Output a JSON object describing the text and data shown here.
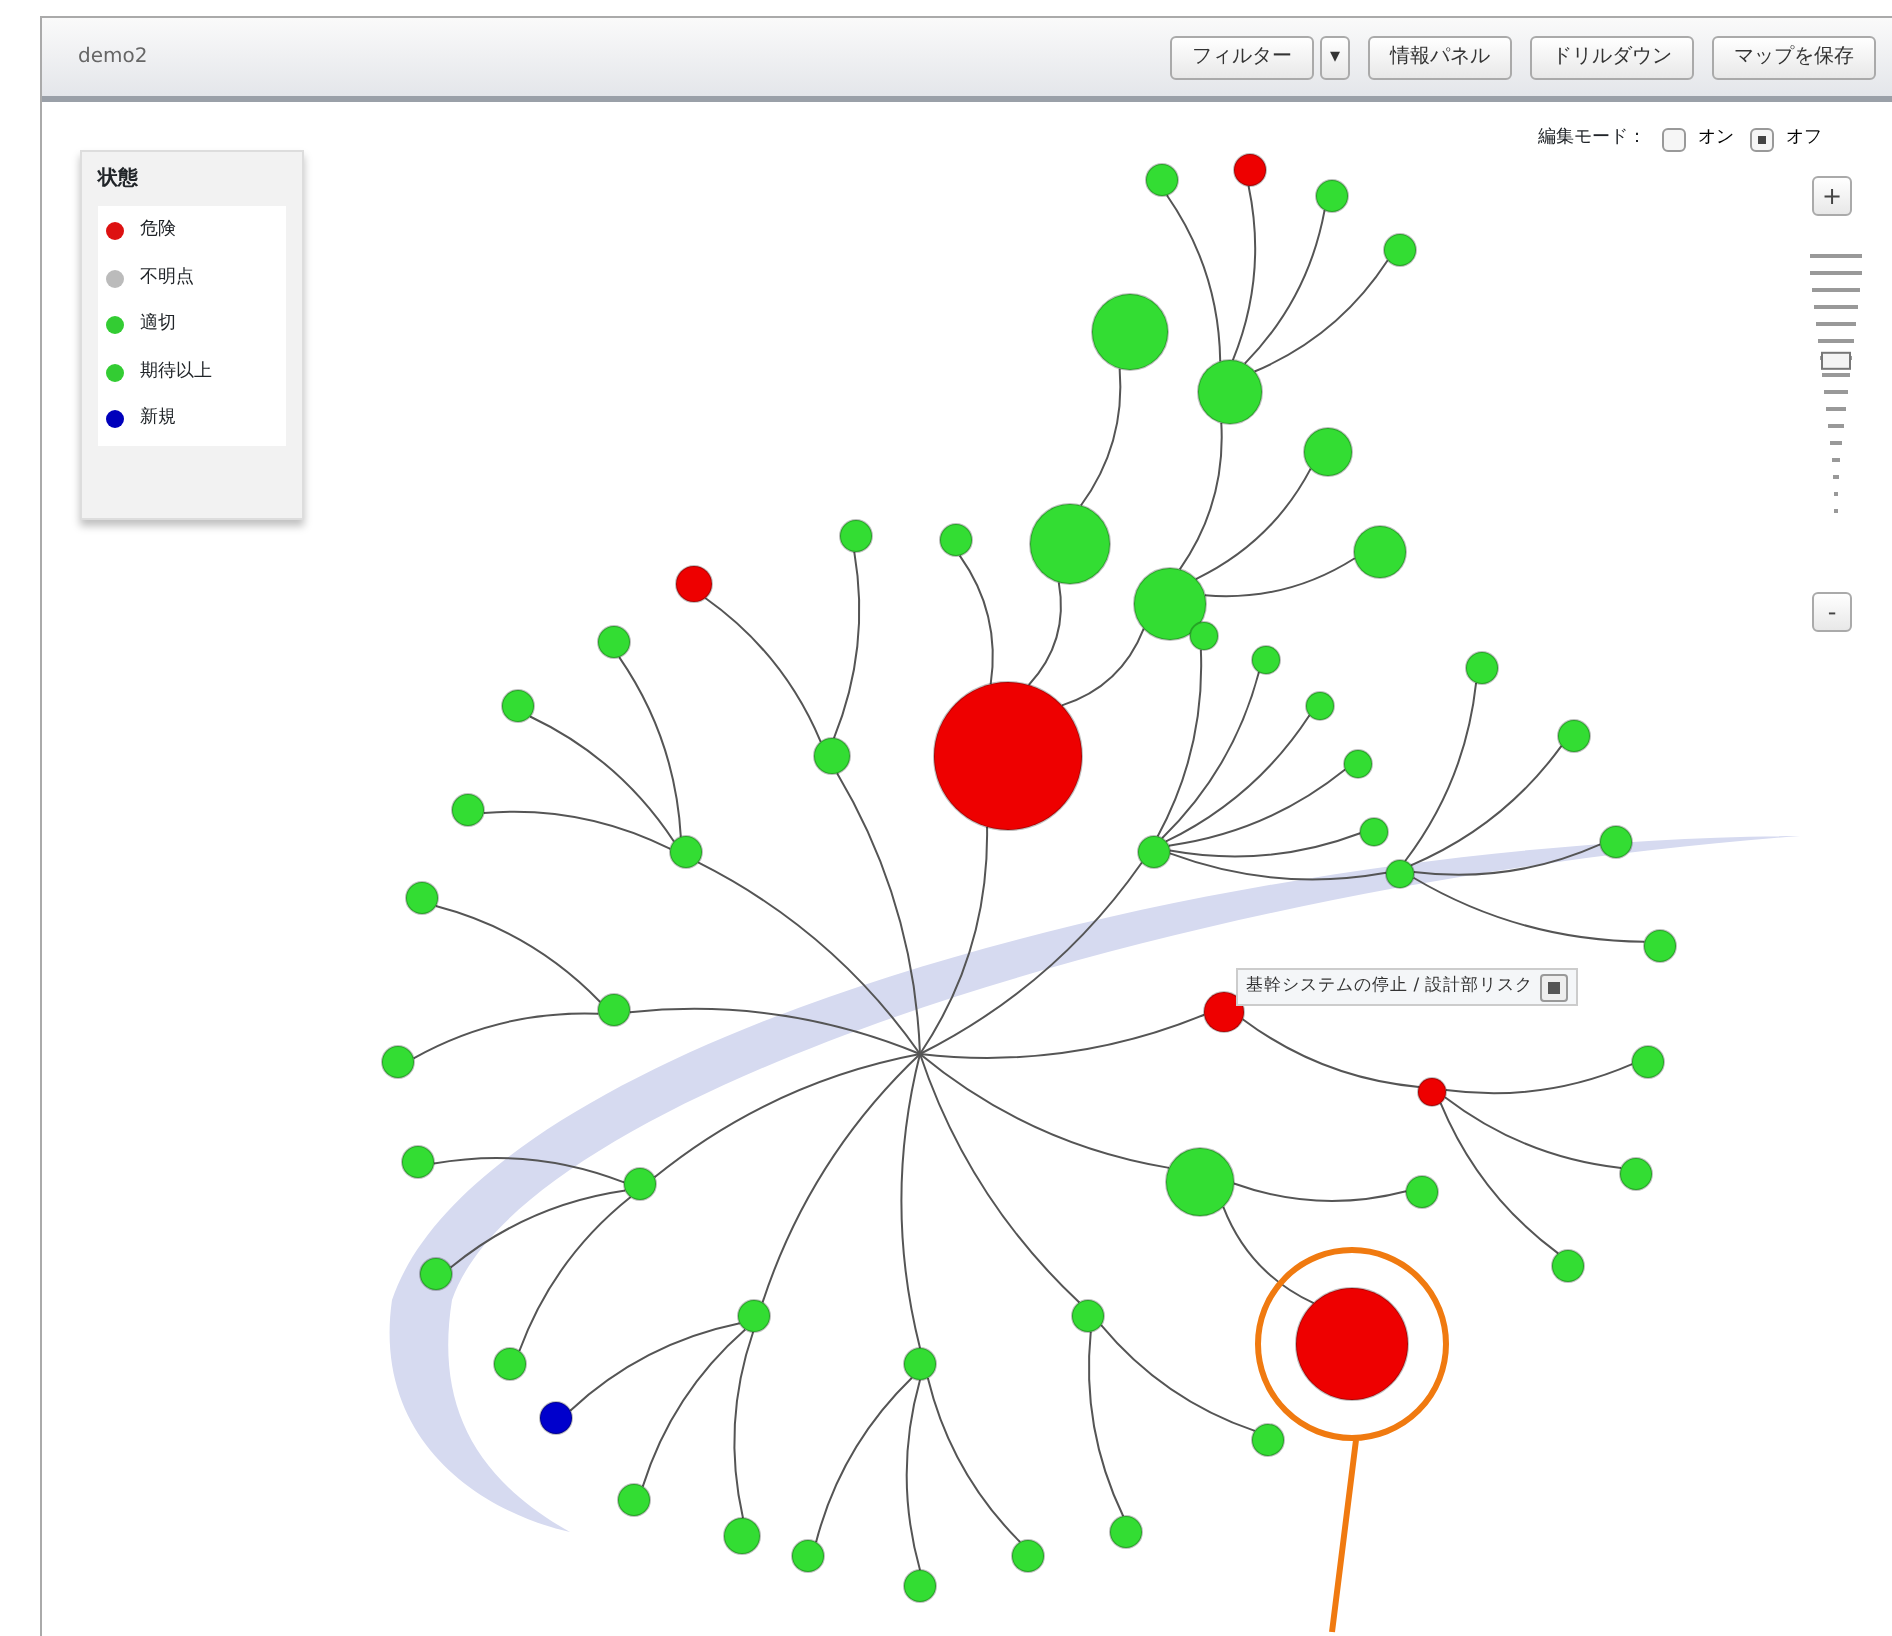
{
  "toolbar": {
    "title": "demo2",
    "buttons": [
      {
        "label": "フィルター",
        "kind": "split",
        "arrow": "▾"
      },
      {
        "label": "情報パネル",
        "kind": "plain"
      },
      {
        "label": "ドリルダウン",
        "kind": "plain"
      },
      {
        "label": "マップを保存",
        "kind": "plain"
      }
    ]
  },
  "legend": {
    "title": "状態",
    "items": [
      {
        "label": "危険",
        "color": "#dd1111"
      },
      {
        "label": "不明点",
        "color": "#bbbbbb"
      },
      {
        "label": "適切",
        "color": "#33cc33"
      },
      {
        "label": "期待以上",
        "color": "#33cc33"
      },
      {
        "label": "新規",
        "color": "#0000bb"
      }
    ]
  },
  "edit_mode": {
    "label": "編集モード：",
    "options": [
      {
        "label": "オン",
        "selected": false
      },
      {
        "label": "オフ",
        "selected": true
      }
    ]
  },
  "zoom": {
    "in": "+",
    "out": "-",
    "level": 0.62
  },
  "tooltip": {
    "text": "基幹システムの停止 / 設計部リスク"
  },
  "graph": {
    "children": [
      {
        "color": "#ee0000",
        "children": [
          {
            "color": "#33dd33",
            "children": [
              {
                "color": "#33dd33"
              }
            ]
          },
          {
            "color": "#33dd33",
            "children": [
              {
                "color": "#33dd33",
                "children": [
                  {
                    "color": "#33dd33"
                  },
                  {
                    "color": "#ee0000"
                  },
                  {
                    "color": "#33dd33"
                  },
                  {
                    "color": "#33dd33"
                  }
                ]
              },
              {
                "color": "#33dd33"
              },
              {
                "color": "#33dd33"
              }
            ]
          },
          {
            "color": "#33dd33"
          }
        ]
      },
      {
        "color": "#33dd33",
        "children": [
          {
            "color": "#33dd33"
          },
          {
            "color": "#ee0000"
          }
        ]
      },
      {
        "color": "#33dd33",
        "children": [
          {
            "color": "#33dd33"
          },
          {
            "color": "#33dd33"
          },
          {
            "color": "#33dd33"
          }
        ]
      },
      {
        "color": "#33dd33",
        "children": [
          {
            "color": "#33dd33"
          },
          {
            "color": "#33dd33"
          }
        ]
      },
      {
        "color": "#33dd33",
        "children": [
          {
            "color": "#33dd33"
          },
          {
            "color": "#33dd33"
          },
          {
            "color": "#33dd33"
          }
        ]
      },
      {
        "color": "#33dd33",
        "children": [
          {
            "color": "#0000cc"
          },
          {
            "color": "#33dd33"
          },
          {
            "color": "#33dd33"
          }
        ]
      },
      {
        "color": "#33dd33",
        "children": [
          {
            "color": "#33dd33"
          },
          {
            "color": "#33dd33"
          },
          {
            "color": "#33dd33"
          }
        ]
      },
      {
        "color": "#33dd33",
        "children": [
          {
            "color": "#33dd33"
          },
          {
            "color": "#33dd33"
          }
        ]
      },
      {
        "color": "#33dd33",
        "children": [
          {
            "color": "#33dd33"
          },
          {
            "color": "#ee0000"
          }
        ]
      },
      {
        "color": "#ee0000",
        "children": [
          {
            "color": "#ee0000",
            "children": [
              {
                "color": "#33dd33"
              },
              {
                "color": "#33dd33"
              },
              {
                "color": "#33dd33"
              }
            ]
          }
        ]
      },
      {
        "color": "#33dd33",
        "children": [
          {
            "color": "#33dd33"
          },
          {
            "color": "#33dd33"
          },
          {
            "color": "#33dd33"
          },
          {
            "color": "#33dd33"
          },
          {
            "color": "#33dd33"
          },
          {
            "color": "#33dd33",
            "children": [
              {
                "color": "#33dd33"
              },
              {
                "color": "#33dd33"
              },
              {
                "color": "#33dd33"
              },
              {
                "color": "#33dd33"
              }
            ]
          }
        ]
      }
    ]
  }
}
